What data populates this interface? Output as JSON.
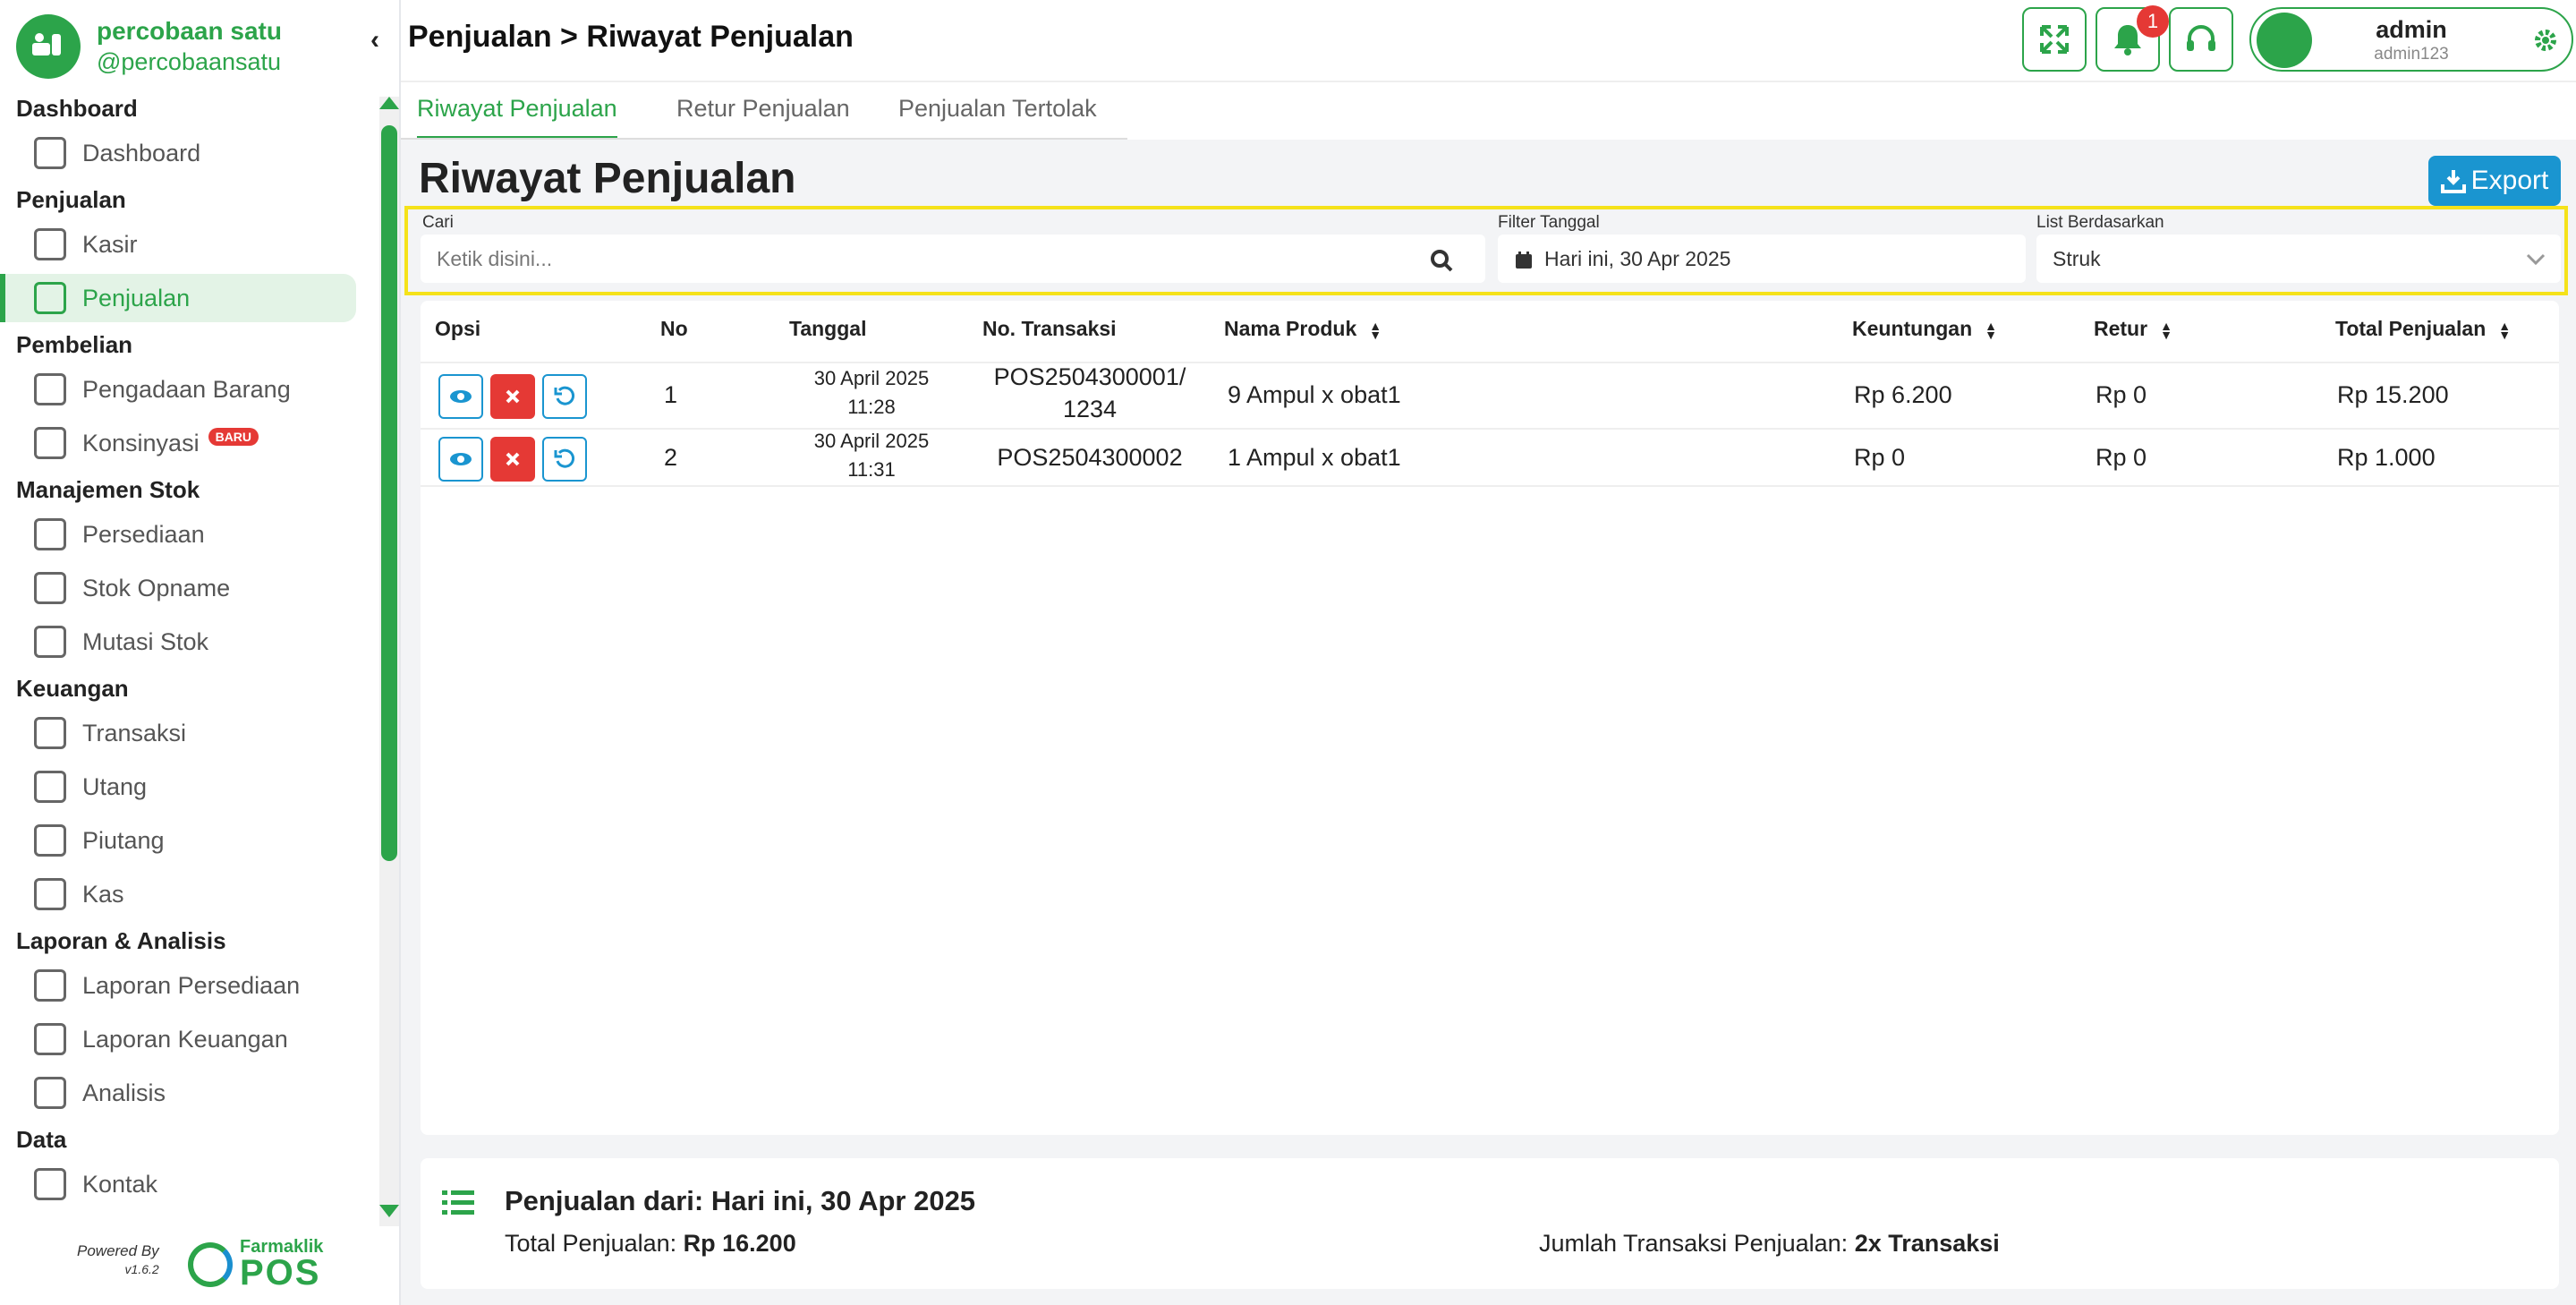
{
  "sidebar": {
    "brand_name": "percobaan satu",
    "brand_handle": "@percobaansatu",
    "sections": [
      {
        "title": "Dashboard",
        "items": [
          {
            "label": "Dashboard"
          }
        ]
      },
      {
        "title": "Penjualan",
        "items": [
          {
            "label": "Kasir"
          },
          {
            "label": "Penjualan"
          }
        ]
      },
      {
        "title": "Pembelian",
        "items": [
          {
            "label": "Pengadaan Barang"
          },
          {
            "label": "Konsinyasi"
          }
        ]
      },
      {
        "title": "Manajemen Stok",
        "items": [
          {
            "label": "Persediaan"
          },
          {
            "label": "Stok Opname"
          },
          {
            "label": "Mutasi Stok"
          }
        ]
      },
      {
        "title": "Keuangan",
        "items": [
          {
            "label": "Transaksi"
          },
          {
            "label": "Utang"
          },
          {
            "label": "Piutang"
          },
          {
            "label": "Kas"
          }
        ]
      },
      {
        "title": "Laporan & Analisis",
        "items": [
          {
            "label": "Laporan Persediaan"
          },
          {
            "label": "Laporan Keuangan"
          },
          {
            "label": "Analisis"
          }
        ]
      },
      {
        "title": "Data",
        "items": [
          {
            "label": "Kontak"
          }
        ]
      }
    ],
    "new_badge": "BARU",
    "powered_by": "Powered By",
    "version": "v1.6.2",
    "footer_brand": "Farmaklik",
    "footer_product": "POS"
  },
  "header": {
    "breadcrumb": "Penjualan > Riwayat Penjualan",
    "notif_count": "1",
    "user_name": "admin",
    "user_id": "admin123"
  },
  "tabs": [
    "Riwayat Penjualan",
    "Retur Penjualan",
    "Penjualan Tertolak"
  ],
  "page": {
    "title": "Riwayat Penjualan",
    "export_label": "Export"
  },
  "filters": {
    "search_label": "Cari",
    "search_placeholder": "Ketik disini...",
    "date_label": "Filter Tanggal",
    "date_value": "Hari ini, 30 Apr 2025",
    "list_label": "List Berdasarkan",
    "list_value": "Struk"
  },
  "table": {
    "headers": [
      "Opsi",
      "No",
      "Tanggal",
      "No. Transaksi",
      "Nama Produk",
      "Keuntungan",
      "Retur",
      "Total Penjualan"
    ],
    "rows": [
      {
        "no": "1",
        "date": "30 April 2025",
        "time": "11:28",
        "trx_a": "POS2504300001/",
        "trx_b": "1234",
        "product": "9 Ampul x obat1",
        "profit": "Rp 6.200",
        "retur": "Rp 0",
        "total": "Rp 15.200"
      },
      {
        "no": "2",
        "date": "30 April 2025",
        "time": "11:31",
        "trx_a": "POS2504300002",
        "trx_b": "",
        "product": "1 Ampul x obat1",
        "profit": "Rp 0",
        "retur": "Rp 0",
        "total": "Rp 1.000"
      }
    ]
  },
  "summary": {
    "title": "Penjualan dari: Hari ini, 30 Apr 2025",
    "total_label": "Total Penjualan: ",
    "total_value": "Rp 16.200",
    "count_label": "Jumlah Transaksi Penjualan: ",
    "count_value": "2x Transaksi"
  },
  "colors": {
    "accent": "#2ca44a",
    "blue": "#1a95d0",
    "danger": "#e53935",
    "highlight": "#f5e21a"
  }
}
